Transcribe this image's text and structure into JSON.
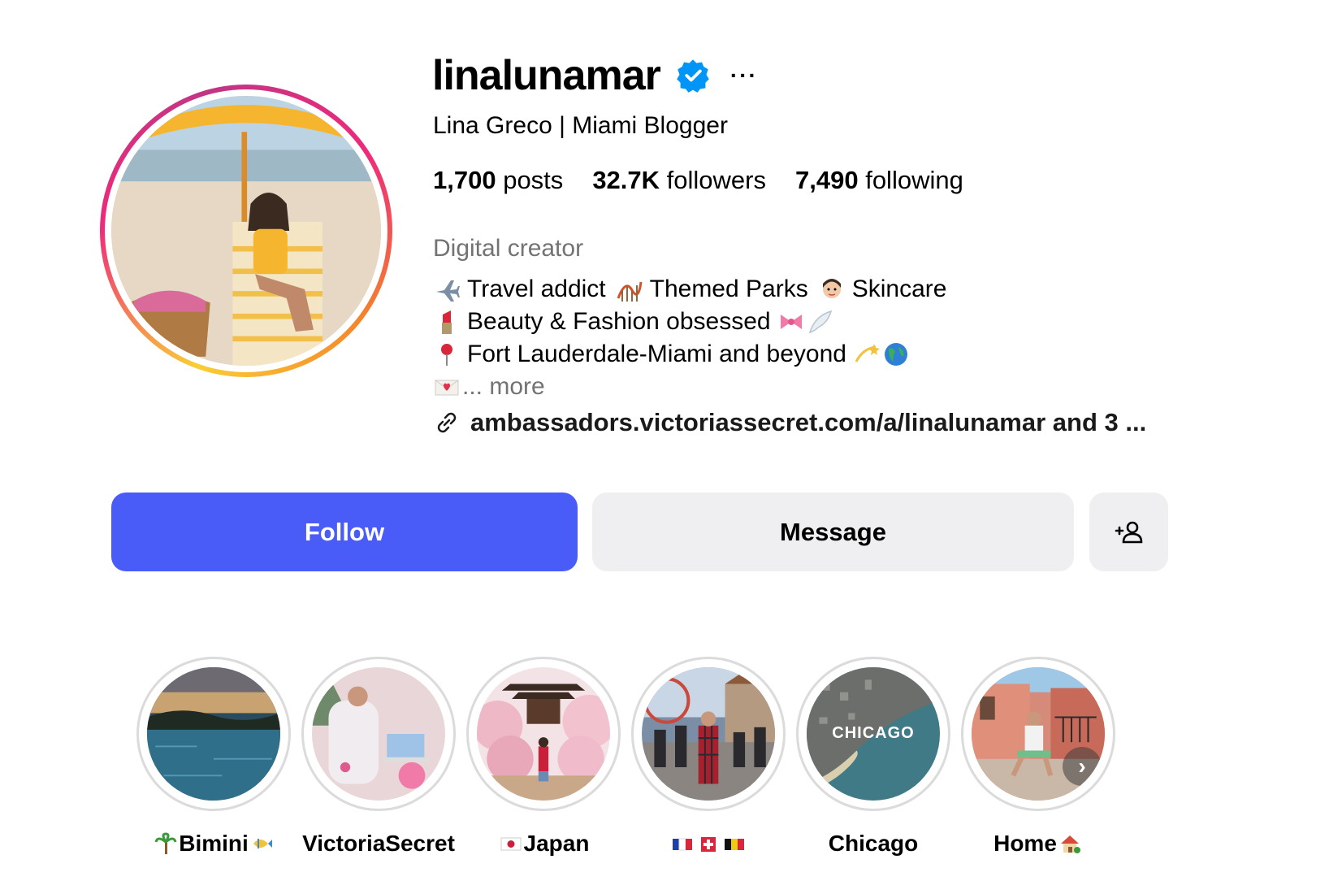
{
  "profile": {
    "username": "linalunamar",
    "verified": true,
    "full_name": "Lina Greco | Miami Blogger",
    "more_icon": "more-horizontal-icon"
  },
  "stats": {
    "posts_count": "1,700",
    "posts_label": "posts",
    "followers_count": "32.7K",
    "followers_label": "followers",
    "following_count": "7,490",
    "following_label": "following"
  },
  "bio": {
    "category": "Digital creator",
    "line1_a": "Travel addict",
    "line1_b": "Themed Parks",
    "line1_c": "Skincare",
    "line2": "Beauty & Fashion obsessed",
    "line3": "Fort Lauderdale-Miami and beyond",
    "line4_more": "... more",
    "link": "ambassadors.victoriassecret.com/a/linalunamar and 3 ..."
  },
  "actions": {
    "follow_label": "Follow",
    "message_label": "Message",
    "add_user_icon": "person-add-icon"
  },
  "highlights": [
    {
      "label": "Bimini"
    },
    {
      "label": "VictoriaSecret"
    },
    {
      "label": "Japan"
    },
    {
      "label": ""
    },
    {
      "label": "Chicago",
      "overlay": "CHICAGO"
    },
    {
      "label": "Home"
    }
  ],
  "colors": {
    "follow_bg": "#4a5cf7",
    "secondary_bg": "#efeff1",
    "verified_blue": "#0095f6",
    "muted_text": "#737373"
  }
}
